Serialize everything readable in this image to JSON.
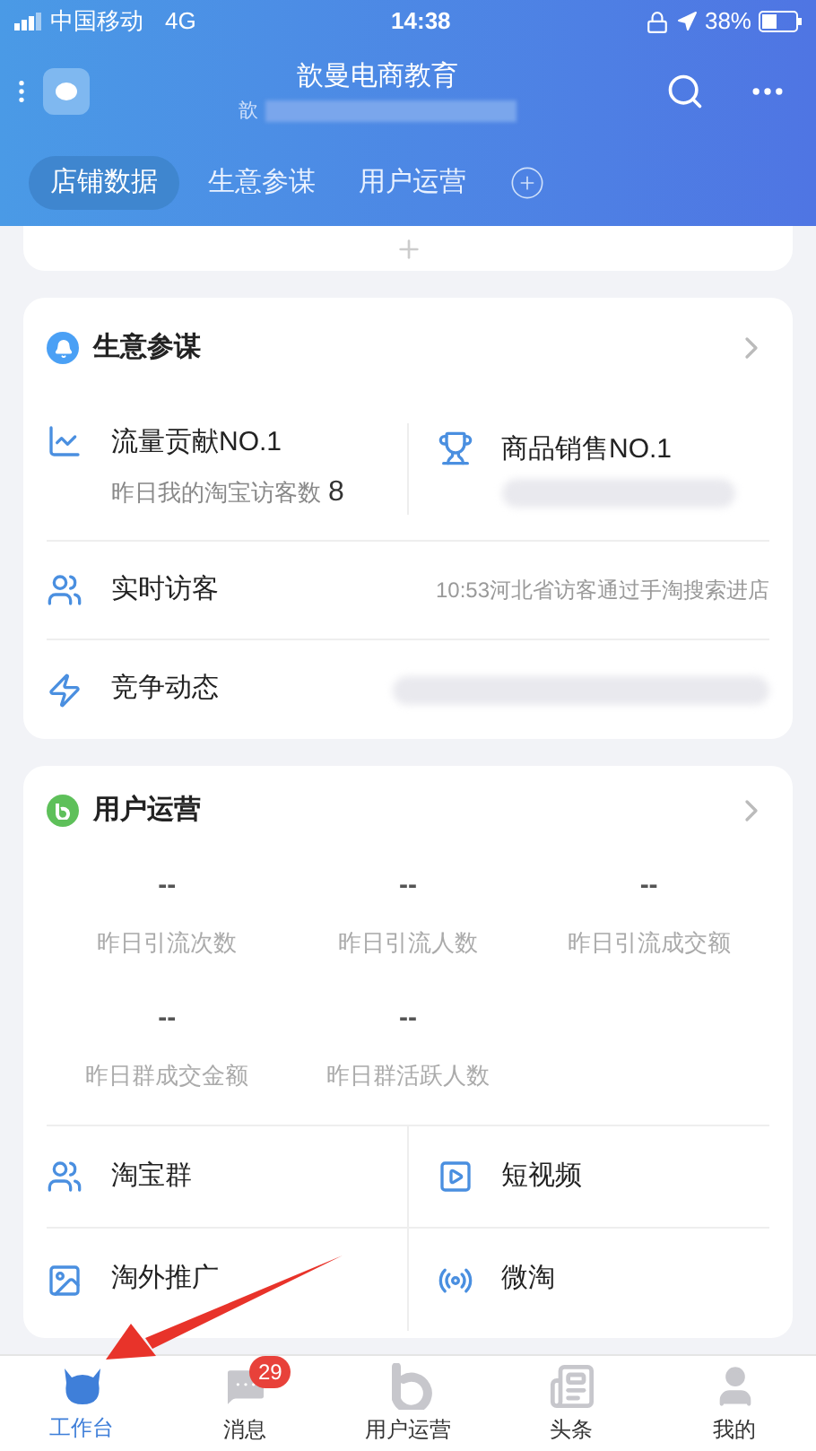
{
  "status_bar": {
    "carrier": "中国移动",
    "network": "4G",
    "time": "14:38",
    "battery": "38%"
  },
  "header": {
    "title": "歆曼电商教育",
    "subtitle": "歆"
  },
  "tabs": [
    {
      "label": "店铺数据",
      "selected": true
    },
    {
      "label": "生意参谋",
      "selected": false
    },
    {
      "label": "用户运营",
      "selected": false
    }
  ],
  "advisor": {
    "title": "生意参谋",
    "highlights": [
      {
        "kind": "trend",
        "title": "流量贡献NO.1",
        "subtitle": "昨日我的淘宝访客数",
        "value": "8"
      },
      {
        "kind": "trophy",
        "title": "商品销售NO.1"
      }
    ],
    "rows": [
      {
        "kind": "visitors",
        "label": "实时访客",
        "detail": "10:53河北省访客通过手淘搜索进店"
      },
      {
        "kind": "competition",
        "label": "竞争动态"
      }
    ]
  },
  "operations": {
    "title": "用户运营",
    "stats": [
      {
        "value": "--",
        "label": "昨日引流次数"
      },
      {
        "value": "--",
        "label": "昨日引流人数"
      },
      {
        "value": "--",
        "label": "昨日引流成交额"
      },
      {
        "value": "--",
        "label": "昨日群成交金额"
      },
      {
        "value": "--",
        "label": "昨日群活跃人数"
      }
    ],
    "links": [
      {
        "kind": "group",
        "label": "淘宝群"
      },
      {
        "kind": "video",
        "label": "短视频"
      },
      {
        "kind": "promo",
        "label": "淘外推广"
      },
      {
        "kind": "weitao",
        "label": "微淘"
      }
    ]
  },
  "bottom_nav": [
    {
      "kind": "workbench",
      "label": "工作台",
      "selected": true
    },
    {
      "kind": "messages",
      "label": "消息",
      "selected": false,
      "badge": "29"
    },
    {
      "kind": "operations",
      "label": "用户运营",
      "selected": false
    },
    {
      "kind": "news",
      "label": "头条",
      "selected": false
    },
    {
      "kind": "profile",
      "label": "我的",
      "selected": false
    }
  ]
}
